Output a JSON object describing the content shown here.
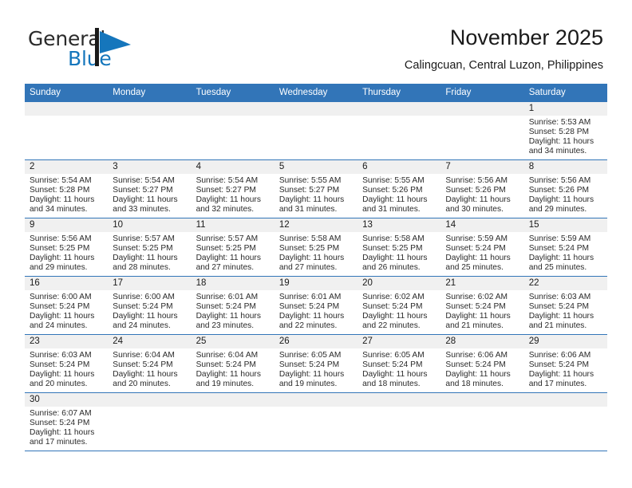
{
  "brand": {
    "name_part1": "General",
    "name_part2": "Blue",
    "flag_icon": "blue-flag-icon",
    "accent_color": "#1576bc"
  },
  "header": {
    "title": "November 2025",
    "subtitle": "Calingcuan, Central Luzon, Philippines"
  },
  "calendar": {
    "header_bg": "#3275b8",
    "header_text_color": "#ffffff",
    "daynum_band_bg": "#f0f0f0",
    "row_divider_color": "#3275b8",
    "weekday_headers": [
      "Sunday",
      "Monday",
      "Tuesday",
      "Wednesday",
      "Thursday",
      "Friday",
      "Saturday"
    ],
    "labels": {
      "sunrise": "Sunrise:",
      "sunset": "Sunset:",
      "daylight": "Daylight:"
    },
    "weeks": [
      [
        {
          "day": "",
          "sunrise": "",
          "sunset": "",
          "daylight_line1": "",
          "daylight_line2": ""
        },
        {
          "day": "",
          "sunrise": "",
          "sunset": "",
          "daylight_line1": "",
          "daylight_line2": ""
        },
        {
          "day": "",
          "sunrise": "",
          "sunset": "",
          "daylight_line1": "",
          "daylight_line2": ""
        },
        {
          "day": "",
          "sunrise": "",
          "sunset": "",
          "daylight_line1": "",
          "daylight_line2": ""
        },
        {
          "day": "",
          "sunrise": "",
          "sunset": "",
          "daylight_line1": "",
          "daylight_line2": ""
        },
        {
          "day": "",
          "sunrise": "",
          "sunset": "",
          "daylight_line1": "",
          "daylight_line2": ""
        },
        {
          "day": "1",
          "sunrise": "Sunrise: 5:53 AM",
          "sunset": "Sunset: 5:28 PM",
          "daylight_line1": "Daylight: 11 hours",
          "daylight_line2": "and 34 minutes."
        }
      ],
      [
        {
          "day": "2",
          "sunrise": "Sunrise: 5:54 AM",
          "sunset": "Sunset: 5:28 PM",
          "daylight_line1": "Daylight: 11 hours",
          "daylight_line2": "and 34 minutes."
        },
        {
          "day": "3",
          "sunrise": "Sunrise: 5:54 AM",
          "sunset": "Sunset: 5:27 PM",
          "daylight_line1": "Daylight: 11 hours",
          "daylight_line2": "and 33 minutes."
        },
        {
          "day": "4",
          "sunrise": "Sunrise: 5:54 AM",
          "sunset": "Sunset: 5:27 PM",
          "daylight_line1": "Daylight: 11 hours",
          "daylight_line2": "and 32 minutes."
        },
        {
          "day": "5",
          "sunrise": "Sunrise: 5:55 AM",
          "sunset": "Sunset: 5:27 PM",
          "daylight_line1": "Daylight: 11 hours",
          "daylight_line2": "and 31 minutes."
        },
        {
          "day": "6",
          "sunrise": "Sunrise: 5:55 AM",
          "sunset": "Sunset: 5:26 PM",
          "daylight_line1": "Daylight: 11 hours",
          "daylight_line2": "and 31 minutes."
        },
        {
          "day": "7",
          "sunrise": "Sunrise: 5:56 AM",
          "sunset": "Sunset: 5:26 PM",
          "daylight_line1": "Daylight: 11 hours",
          "daylight_line2": "and 30 minutes."
        },
        {
          "day": "8",
          "sunrise": "Sunrise: 5:56 AM",
          "sunset": "Sunset: 5:26 PM",
          "daylight_line1": "Daylight: 11 hours",
          "daylight_line2": "and 29 minutes."
        }
      ],
      [
        {
          "day": "9",
          "sunrise": "Sunrise: 5:56 AM",
          "sunset": "Sunset: 5:25 PM",
          "daylight_line1": "Daylight: 11 hours",
          "daylight_line2": "and 29 minutes."
        },
        {
          "day": "10",
          "sunrise": "Sunrise: 5:57 AM",
          "sunset": "Sunset: 5:25 PM",
          "daylight_line1": "Daylight: 11 hours",
          "daylight_line2": "and 28 minutes."
        },
        {
          "day": "11",
          "sunrise": "Sunrise: 5:57 AM",
          "sunset": "Sunset: 5:25 PM",
          "daylight_line1": "Daylight: 11 hours",
          "daylight_line2": "and 27 minutes."
        },
        {
          "day": "12",
          "sunrise": "Sunrise: 5:58 AM",
          "sunset": "Sunset: 5:25 PM",
          "daylight_line1": "Daylight: 11 hours",
          "daylight_line2": "and 27 minutes."
        },
        {
          "day": "13",
          "sunrise": "Sunrise: 5:58 AM",
          "sunset": "Sunset: 5:25 PM",
          "daylight_line1": "Daylight: 11 hours",
          "daylight_line2": "and 26 minutes."
        },
        {
          "day": "14",
          "sunrise": "Sunrise: 5:59 AM",
          "sunset": "Sunset: 5:24 PM",
          "daylight_line1": "Daylight: 11 hours",
          "daylight_line2": "and 25 minutes."
        },
        {
          "day": "15",
          "sunrise": "Sunrise: 5:59 AM",
          "sunset": "Sunset: 5:24 PM",
          "daylight_line1": "Daylight: 11 hours",
          "daylight_line2": "and 25 minutes."
        }
      ],
      [
        {
          "day": "16",
          "sunrise": "Sunrise: 6:00 AM",
          "sunset": "Sunset: 5:24 PM",
          "daylight_line1": "Daylight: 11 hours",
          "daylight_line2": "and 24 minutes."
        },
        {
          "day": "17",
          "sunrise": "Sunrise: 6:00 AM",
          "sunset": "Sunset: 5:24 PM",
          "daylight_line1": "Daylight: 11 hours",
          "daylight_line2": "and 24 minutes."
        },
        {
          "day": "18",
          "sunrise": "Sunrise: 6:01 AM",
          "sunset": "Sunset: 5:24 PM",
          "daylight_line1": "Daylight: 11 hours",
          "daylight_line2": "and 23 minutes."
        },
        {
          "day": "19",
          "sunrise": "Sunrise: 6:01 AM",
          "sunset": "Sunset: 5:24 PM",
          "daylight_line1": "Daylight: 11 hours",
          "daylight_line2": "and 22 minutes."
        },
        {
          "day": "20",
          "sunrise": "Sunrise: 6:02 AM",
          "sunset": "Sunset: 5:24 PM",
          "daylight_line1": "Daylight: 11 hours",
          "daylight_line2": "and 22 minutes."
        },
        {
          "day": "21",
          "sunrise": "Sunrise: 6:02 AM",
          "sunset": "Sunset: 5:24 PM",
          "daylight_line1": "Daylight: 11 hours",
          "daylight_line2": "and 21 minutes."
        },
        {
          "day": "22",
          "sunrise": "Sunrise: 6:03 AM",
          "sunset": "Sunset: 5:24 PM",
          "daylight_line1": "Daylight: 11 hours",
          "daylight_line2": "and 21 minutes."
        }
      ],
      [
        {
          "day": "23",
          "sunrise": "Sunrise: 6:03 AM",
          "sunset": "Sunset: 5:24 PM",
          "daylight_line1": "Daylight: 11 hours",
          "daylight_line2": "and 20 minutes."
        },
        {
          "day": "24",
          "sunrise": "Sunrise: 6:04 AM",
          "sunset": "Sunset: 5:24 PM",
          "daylight_line1": "Daylight: 11 hours",
          "daylight_line2": "and 20 minutes."
        },
        {
          "day": "25",
          "sunrise": "Sunrise: 6:04 AM",
          "sunset": "Sunset: 5:24 PM",
          "daylight_line1": "Daylight: 11 hours",
          "daylight_line2": "and 19 minutes."
        },
        {
          "day": "26",
          "sunrise": "Sunrise: 6:05 AM",
          "sunset": "Sunset: 5:24 PM",
          "daylight_line1": "Daylight: 11 hours",
          "daylight_line2": "and 19 minutes."
        },
        {
          "day": "27",
          "sunrise": "Sunrise: 6:05 AM",
          "sunset": "Sunset: 5:24 PM",
          "daylight_line1": "Daylight: 11 hours",
          "daylight_line2": "and 18 minutes."
        },
        {
          "day": "28",
          "sunrise": "Sunrise: 6:06 AM",
          "sunset": "Sunset: 5:24 PM",
          "daylight_line1": "Daylight: 11 hours",
          "daylight_line2": "and 18 minutes."
        },
        {
          "day": "29",
          "sunrise": "Sunrise: 6:06 AM",
          "sunset": "Sunset: 5:24 PM",
          "daylight_line1": "Daylight: 11 hours",
          "daylight_line2": "and 17 minutes."
        }
      ],
      [
        {
          "day": "30",
          "sunrise": "Sunrise: 6:07 AM",
          "sunset": "Sunset: 5:24 PM",
          "daylight_line1": "Daylight: 11 hours",
          "daylight_line2": "and 17 minutes."
        },
        {
          "day": "",
          "sunrise": "",
          "sunset": "",
          "daylight_line1": "",
          "daylight_line2": ""
        },
        {
          "day": "",
          "sunrise": "",
          "sunset": "",
          "daylight_line1": "",
          "daylight_line2": ""
        },
        {
          "day": "",
          "sunrise": "",
          "sunset": "",
          "daylight_line1": "",
          "daylight_line2": ""
        },
        {
          "day": "",
          "sunrise": "",
          "sunset": "",
          "daylight_line1": "",
          "daylight_line2": ""
        },
        {
          "day": "",
          "sunrise": "",
          "sunset": "",
          "daylight_line1": "",
          "daylight_line2": ""
        },
        {
          "day": "",
          "sunrise": "",
          "sunset": "",
          "daylight_line1": "",
          "daylight_line2": ""
        }
      ]
    ]
  }
}
